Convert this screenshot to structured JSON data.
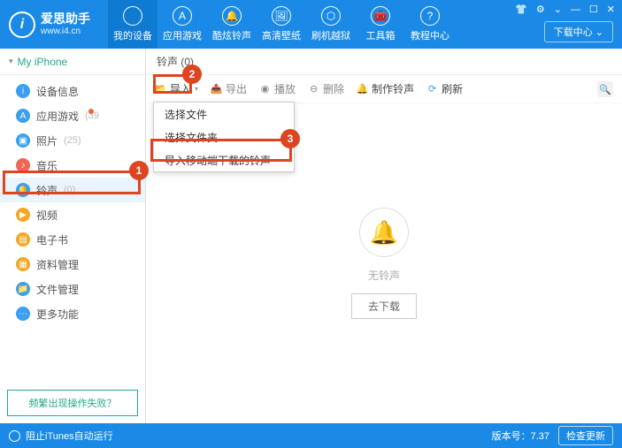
{
  "brand": {
    "name": "爱思助手",
    "url": "www.i4.cn",
    "logo_letter": "i"
  },
  "winctrl": {
    "settings_icon": "⚙",
    "gear_icon": "⌄",
    "min_icon": "—",
    "max_icon": "☐",
    "close_icon": "✕"
  },
  "download_center": "下载中心 ⌄",
  "topnav": [
    {
      "label": "我的设备",
      "icon": ""
    },
    {
      "label": "应用游戏",
      "icon": "A"
    },
    {
      "label": "酷炫铃声",
      "icon": "🔔"
    },
    {
      "label": "高清壁纸",
      "icon": "🖼"
    },
    {
      "label": "刷机越狱",
      "icon": "⬡"
    },
    {
      "label": "工具箱",
      "icon": "🧰"
    },
    {
      "label": "教程中心",
      "icon": "?"
    }
  ],
  "device_name": "My iPhone",
  "sidebar": [
    {
      "label": "设备信息",
      "count": "",
      "icon": "i",
      "color": "#3aa0ef"
    },
    {
      "label": "应用游戏",
      "count": "(39",
      "icon": "A",
      "color": "#3aa0ef",
      "badge": true
    },
    {
      "label": "照片",
      "count": "(25)",
      "icon": "▣",
      "color": "#3aa0ef"
    },
    {
      "label": "音乐",
      "count": "",
      "icon": "♪",
      "color": "#e65"
    },
    {
      "label": "铃声",
      "count": "(0)",
      "icon": "🔔",
      "color": "#3aa0ef",
      "active": true
    },
    {
      "label": "视频",
      "count": "",
      "icon": "▶",
      "color": "#f5a623"
    },
    {
      "label": "电子书",
      "count": "",
      "icon": "▤",
      "color": "#f5a623"
    },
    {
      "label": "资料管理",
      "count": "",
      "icon": "▦",
      "color": "#f5a623"
    },
    {
      "label": "文件管理",
      "count": "",
      "icon": "📁",
      "color": "#3aa0ef"
    },
    {
      "label": "更多功能",
      "count": "",
      "icon": "⋯",
      "color": "#3aa0ef"
    }
  ],
  "help_link": "频繁出现操作失败？",
  "tab_header": "铃声 (0)",
  "toolbar": {
    "import": "导入",
    "export": "导出",
    "play": "播放",
    "delete": "删除",
    "make": "制作铃声",
    "refresh": "刷新"
  },
  "dropdown": {
    "opt1": "选择文件",
    "opt2": "选择文件夹",
    "opt3": "导入移动端下载的铃声"
  },
  "empty": {
    "text": "无铃声",
    "button": "去下载"
  },
  "status": {
    "left": "阻止iTunes自动运行",
    "version_label": "版本号：",
    "version": "7.37",
    "update": "检查更新"
  },
  "callouts": {
    "n1": "1",
    "n2": "2",
    "n3": "3"
  }
}
